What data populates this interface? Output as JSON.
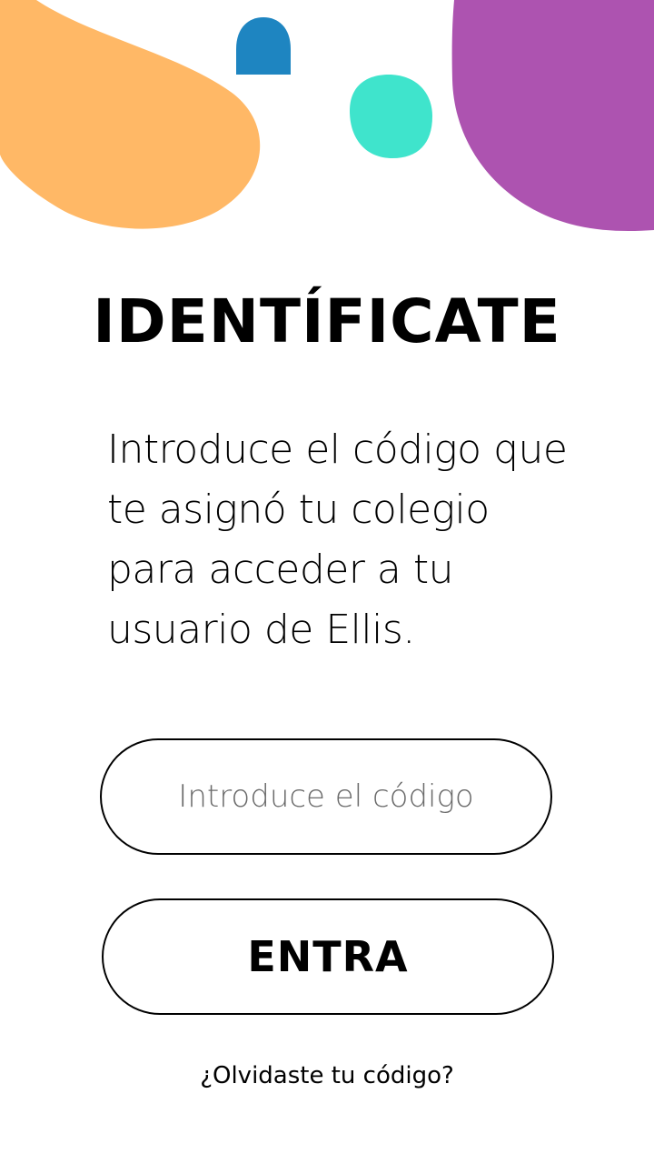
{
  "screen": {
    "title": "IDENTÍFICATE",
    "intro": "Introduce el código que te asignó tu colegio para acceder a tu usuario de Ellis.",
    "code_input": {
      "placeholder": "Introduce el código",
      "value": ""
    },
    "enter_button": {
      "label": "ENTRA"
    },
    "forgot_link": {
      "label": "¿Olvidaste tu código?"
    }
  },
  "decor": {
    "colors": {
      "orange": "#FFB866",
      "blue": "#1E85C1",
      "teal": "#3FE4CC",
      "purple": "#AD53B0"
    }
  }
}
